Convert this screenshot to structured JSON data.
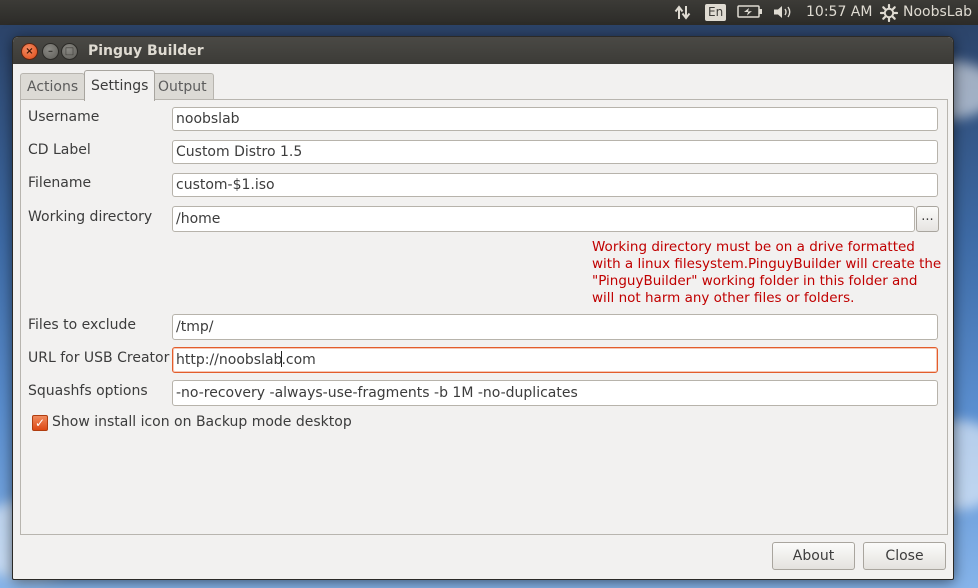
{
  "top_panel": {
    "keyboard_layout": "En",
    "clock": "10:57 AM",
    "user": "NoobsLab",
    "icons": [
      "network-transfer-icon",
      "keyboard-layout-icon",
      "battery-icon",
      "volume-icon",
      "gear-icon"
    ]
  },
  "window": {
    "title": "Pinguy Builder",
    "controls": {
      "close": "×",
      "minimize": "–",
      "maximize": "□"
    }
  },
  "tabs": [
    {
      "label": "Actions",
      "active": false
    },
    {
      "label": "Settings",
      "active": true
    },
    {
      "label": "Output",
      "active": false
    }
  ],
  "settings": {
    "username": {
      "label": "Username",
      "value": "noobslab"
    },
    "cd_label": {
      "label": "CD Label",
      "value": "Custom Distro 1.5"
    },
    "filename": {
      "label": "Filename",
      "value": "custom-$1.iso"
    },
    "working_directory": {
      "label": "Working directory",
      "value": "/home",
      "browse_label": "..."
    },
    "warning": "Working directory must be on a drive formatted with a linux filesystem.PinguyBuilder will create the \"PinguyBuilder\" working folder in this folder and will not harm any other files or folders.",
    "files_to_exclude": {
      "label": "Files to exclude",
      "value": "/tmp/"
    },
    "usb_creator_url": {
      "label": "URL for USB Creator",
      "value_before_caret": "http://noobslab",
      "value_after_caret": ".com"
    },
    "squashfs_options": {
      "label": "Squashfs options",
      "value": "-no-recovery -always-use-fragments -b 1M -no-duplicates"
    },
    "show_install_icon": {
      "label": "Show install icon on Backup mode desktop",
      "checked": true
    }
  },
  "buttons": {
    "about": "About",
    "close": "Close"
  },
  "colors": {
    "accent": "#dd4814",
    "warning_text": "#c00000",
    "panel_bg": "#3c3b37"
  }
}
